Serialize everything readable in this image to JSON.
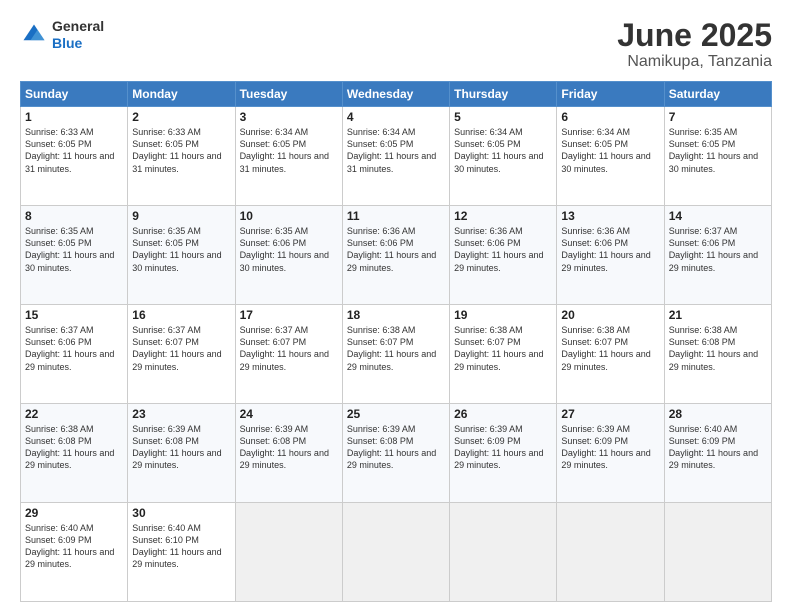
{
  "header": {
    "logo_general": "General",
    "logo_blue": "Blue",
    "title": "June 2025",
    "subtitle": "Namikupa, Tanzania"
  },
  "calendar": {
    "headers": [
      "Sunday",
      "Monday",
      "Tuesday",
      "Wednesday",
      "Thursday",
      "Friday",
      "Saturday"
    ],
    "weeks": [
      [
        {
          "day": "",
          "empty": true
        },
        {
          "day": "",
          "empty": true
        },
        {
          "day": "",
          "empty": true
        },
        {
          "day": "",
          "empty": true
        },
        {
          "day": "5",
          "sunrise": "6:34 AM",
          "sunset": "6:05 PM",
          "daylight": "11 hours and 30 minutes."
        },
        {
          "day": "6",
          "sunrise": "6:34 AM",
          "sunset": "6:05 PM",
          "daylight": "11 hours and 30 minutes."
        },
        {
          "day": "7",
          "sunrise": "6:35 AM",
          "sunset": "6:05 PM",
          "daylight": "11 hours and 30 minutes."
        }
      ],
      [
        {
          "day": "1",
          "sunrise": "6:33 AM",
          "sunset": "6:05 PM",
          "daylight": "11 hours and 31 minutes."
        },
        {
          "day": "2",
          "sunrise": "6:33 AM",
          "sunset": "6:05 PM",
          "daylight": "11 hours and 31 minutes."
        },
        {
          "day": "3",
          "sunrise": "6:34 AM",
          "sunset": "6:05 PM",
          "daylight": "11 hours and 31 minutes."
        },
        {
          "day": "4",
          "sunrise": "6:34 AM",
          "sunset": "6:05 PM",
          "daylight": "11 hours and 31 minutes."
        },
        {
          "day": "5",
          "sunrise": "6:34 AM",
          "sunset": "6:05 PM",
          "daylight": "11 hours and 30 minutes."
        },
        {
          "day": "6",
          "sunrise": "6:34 AM",
          "sunset": "6:05 PM",
          "daylight": "11 hours and 30 minutes."
        },
        {
          "day": "7",
          "sunrise": "6:35 AM",
          "sunset": "6:05 PM",
          "daylight": "11 hours and 30 minutes."
        }
      ],
      [
        {
          "day": "8",
          "sunrise": "6:35 AM",
          "sunset": "6:05 PM",
          "daylight": "11 hours and 30 minutes."
        },
        {
          "day": "9",
          "sunrise": "6:35 AM",
          "sunset": "6:05 PM",
          "daylight": "11 hours and 30 minutes."
        },
        {
          "day": "10",
          "sunrise": "6:35 AM",
          "sunset": "6:06 PM",
          "daylight": "11 hours and 30 minutes."
        },
        {
          "day": "11",
          "sunrise": "6:36 AM",
          "sunset": "6:06 PM",
          "daylight": "11 hours and 29 minutes."
        },
        {
          "day": "12",
          "sunrise": "6:36 AM",
          "sunset": "6:06 PM",
          "daylight": "11 hours and 29 minutes."
        },
        {
          "day": "13",
          "sunrise": "6:36 AM",
          "sunset": "6:06 PM",
          "daylight": "11 hours and 29 minutes."
        },
        {
          "day": "14",
          "sunrise": "6:37 AM",
          "sunset": "6:06 PM",
          "daylight": "11 hours and 29 minutes."
        }
      ],
      [
        {
          "day": "15",
          "sunrise": "6:37 AM",
          "sunset": "6:06 PM",
          "daylight": "11 hours and 29 minutes."
        },
        {
          "day": "16",
          "sunrise": "6:37 AM",
          "sunset": "6:07 PM",
          "daylight": "11 hours and 29 minutes."
        },
        {
          "day": "17",
          "sunrise": "6:37 AM",
          "sunset": "6:07 PM",
          "daylight": "11 hours and 29 minutes."
        },
        {
          "day": "18",
          "sunrise": "6:38 AM",
          "sunset": "6:07 PM",
          "daylight": "11 hours and 29 minutes."
        },
        {
          "day": "19",
          "sunrise": "6:38 AM",
          "sunset": "6:07 PM",
          "daylight": "11 hours and 29 minutes."
        },
        {
          "day": "20",
          "sunrise": "6:38 AM",
          "sunset": "6:07 PM",
          "daylight": "11 hours and 29 minutes."
        },
        {
          "day": "21",
          "sunrise": "6:38 AM",
          "sunset": "6:08 PM",
          "daylight": "11 hours and 29 minutes."
        }
      ],
      [
        {
          "day": "22",
          "sunrise": "6:38 AM",
          "sunset": "6:08 PM",
          "daylight": "11 hours and 29 minutes."
        },
        {
          "day": "23",
          "sunrise": "6:39 AM",
          "sunset": "6:08 PM",
          "daylight": "11 hours and 29 minutes."
        },
        {
          "day": "24",
          "sunrise": "6:39 AM",
          "sunset": "6:08 PM",
          "daylight": "11 hours and 29 minutes."
        },
        {
          "day": "25",
          "sunrise": "6:39 AM",
          "sunset": "6:08 PM",
          "daylight": "11 hours and 29 minutes."
        },
        {
          "day": "26",
          "sunrise": "6:39 AM",
          "sunset": "6:09 PM",
          "daylight": "11 hours and 29 minutes."
        },
        {
          "day": "27",
          "sunrise": "6:39 AM",
          "sunset": "6:09 PM",
          "daylight": "11 hours and 29 minutes."
        },
        {
          "day": "28",
          "sunrise": "6:40 AM",
          "sunset": "6:09 PM",
          "daylight": "11 hours and 29 minutes."
        }
      ],
      [
        {
          "day": "29",
          "sunrise": "6:40 AM",
          "sunset": "6:09 PM",
          "daylight": "11 hours and 29 minutes."
        },
        {
          "day": "30",
          "sunrise": "6:40 AM",
          "sunset": "6:10 PM",
          "daylight": "11 hours and 29 minutes."
        },
        {
          "day": "",
          "empty": true
        },
        {
          "day": "",
          "empty": true
        },
        {
          "day": "",
          "empty": true
        },
        {
          "day": "",
          "empty": true
        },
        {
          "day": "",
          "empty": true
        }
      ]
    ]
  }
}
